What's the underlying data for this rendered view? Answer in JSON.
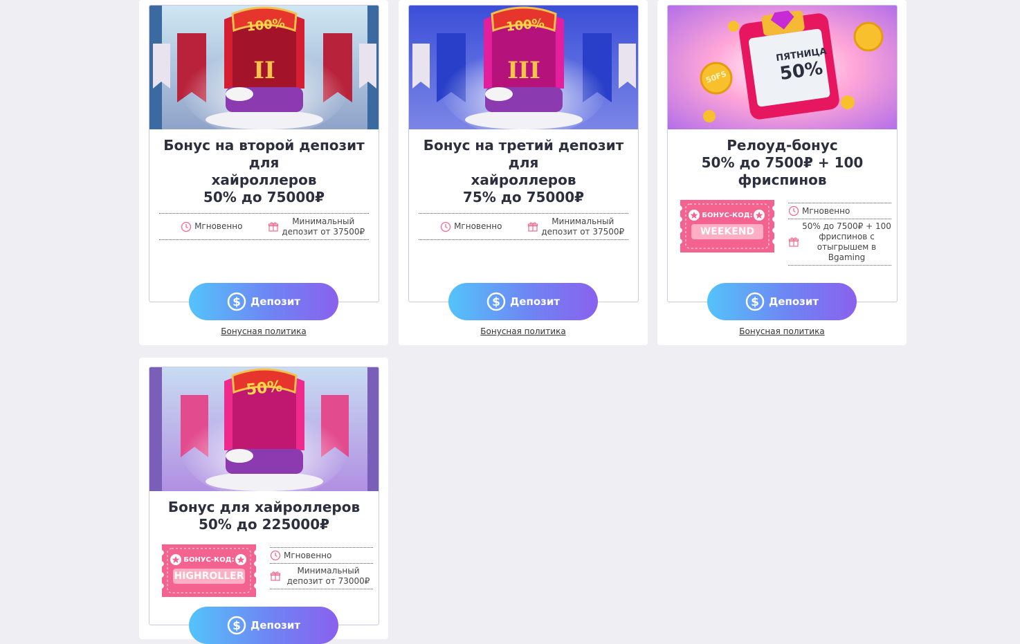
{
  "colors": {
    "background": "#eeeef3",
    "accent_pink": "#f4628f",
    "button_start": "#54c3fa",
    "button_end": "#8a61ee"
  },
  "cards": [
    {
      "title_line1": "Бонус на второй депозит для",
      "title_line2": "хайроллеров",
      "title_line3": "50% до 75000₽",
      "image_badge": "100%",
      "image_numeral": "II",
      "timing": "Мгновенно",
      "min_deposit_l1": "Минимальный",
      "min_deposit_l2": "депозит от 37500₽",
      "button": "Депозит",
      "policy": "Бонусная политика"
    },
    {
      "title_line1": "Бонус на третий депозит для",
      "title_line2": "хайроллеров",
      "title_line3": "75% до 75000₽",
      "image_badge": "100%",
      "image_numeral": "III",
      "timing": "Мгновенно",
      "min_deposit_l1": "Минимальный",
      "min_deposit_l2": "депозит от 37500₽",
      "button": "Депозит",
      "policy": "Бонусная политика"
    },
    {
      "title_line1": "Релоуд-бонус",
      "title_line2": "50% до 7500₽ + 100",
      "title_line3": "фриспинов",
      "image_day": "ПЯТНИЦА",
      "image_pct": "50%",
      "image_coin": "50FS",
      "code_label": "БОНУС-КОД:",
      "code": "WEEKEND",
      "timing": "Мгновенно",
      "detail_l1": "50% до 7500₽ + 100",
      "detail_l2": "фриспинов с",
      "detail_l3": "отыгрышем в",
      "detail_l4": "Bgaming",
      "button": "Депозит",
      "policy": "Бонусная политика"
    },
    {
      "title_line1": "Бонус для хайроллеров",
      "title_line2": "50% до 225000₽",
      "image_badge": "50%",
      "code_label": "БОНУС-КОД:",
      "code": "HIGHROLLER",
      "timing": "Мгновенно",
      "min_deposit_l1": "Минимальный",
      "min_deposit_l2": "депозит от 73000₽",
      "button": "Депозит"
    }
  ]
}
